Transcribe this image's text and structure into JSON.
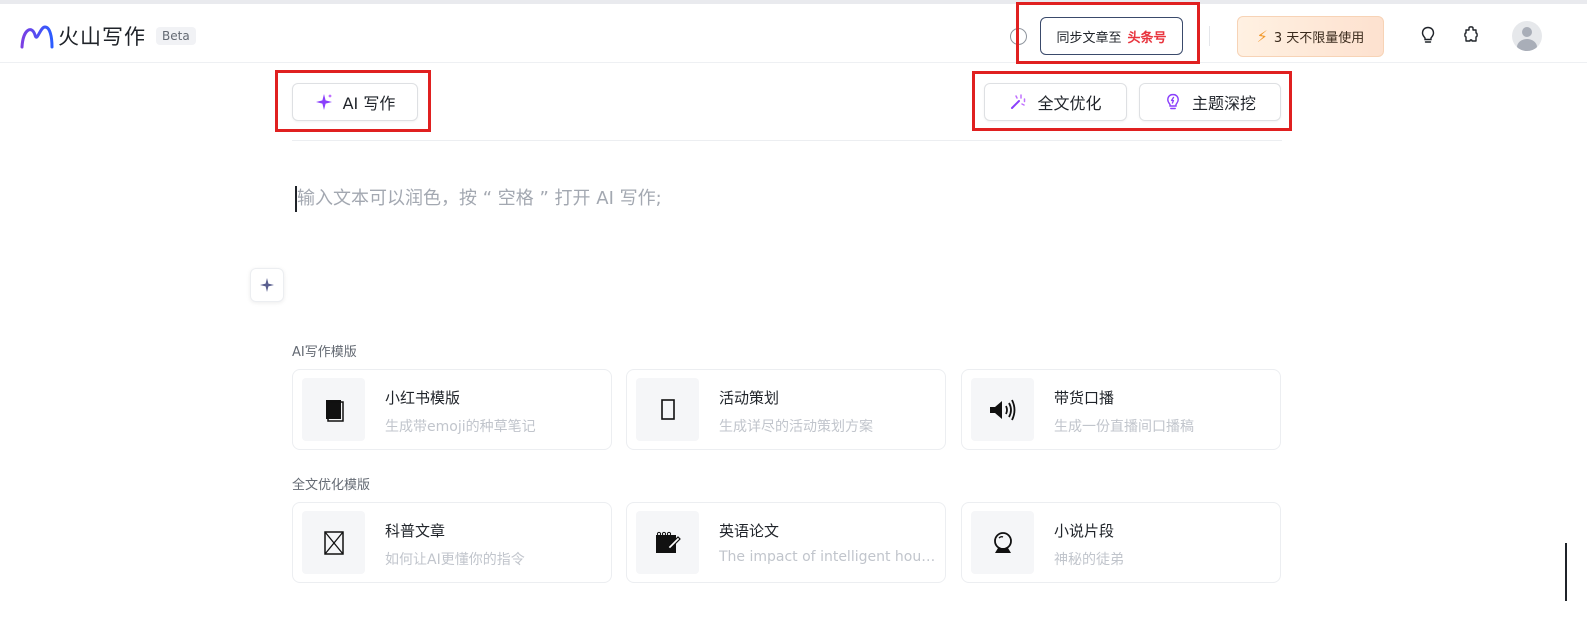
{
  "header": {
    "logo_text": "火山写作",
    "beta_label": "Beta",
    "sync_label": "同步文章至",
    "sync_brand": "头条号",
    "trial_label": "3 天不限量使用",
    "trial_icon": "lightning-icon"
  },
  "toolbar": {
    "ai_write_label": "AI 写作",
    "optimize_label": "全文优化",
    "deepdig_label": "主题深挖"
  },
  "editor": {
    "placeholder": "输入文本可以润色，按 “ 空格 ” 打开 AI 写作;"
  },
  "sections": {
    "ai_templates_title": "AI写作模版",
    "optimize_templates_title": "全文优化模版"
  },
  "ai_templates": [
    {
      "title": "小红书模版",
      "desc": "生成带emoji的种草笔记",
      "icon": "book-icon"
    },
    {
      "title": "活动策划",
      "desc": "生成详尽的活动策划方案",
      "icon": "clipboard-icon"
    },
    {
      "title": "带货口播",
      "desc": "生成一份直播间口播稿",
      "icon": "speaker-icon"
    }
  ],
  "optimize_templates": [
    {
      "title": "科普文章",
      "desc": "如何让AI更懂你的指令",
      "icon": "box-icon"
    },
    {
      "title": "英语论文",
      "desc": "The impact of intelligent hous...",
      "icon": "notepad-icon"
    },
    {
      "title": "小说片段",
      "desc": "神秘的徒弟",
      "icon": "crystal-ball-icon"
    }
  ],
  "colors": {
    "accent": "#8a3ffc",
    "brand_red": "#e8343e",
    "annotation_red": "#e02020"
  }
}
